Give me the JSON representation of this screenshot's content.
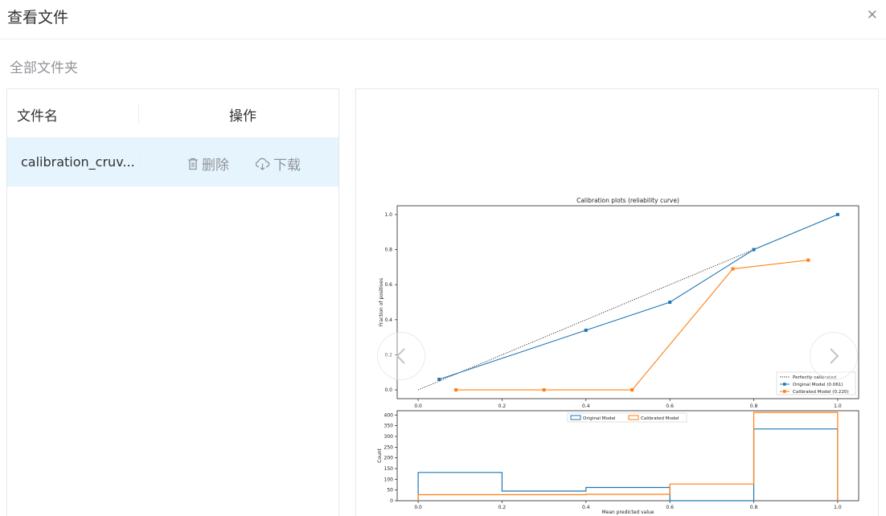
{
  "dialog": {
    "title": "查看文件",
    "close_glyph": "✕"
  },
  "breadcrumb": {
    "label": "全部文件夹"
  },
  "table": {
    "headers": {
      "name": "文件名",
      "actions": "操作"
    },
    "rows": [
      {
        "name": "calibration_cruv...",
        "delete_label": "删除",
        "download_label": "下载"
      }
    ]
  },
  "icons": {
    "delete": "trash-icon",
    "download": "cloud-download-icon",
    "prev": "chevron-left-icon",
    "next": "chevron-right-icon"
  },
  "colors": {
    "original": "#1f77b4",
    "calibrated": "#ff7f0e",
    "row_highlight": "#e6f4fd"
  },
  "chart_data": [
    {
      "type": "line",
      "title": "Calibration plots  (reliability curve)",
      "xlabel": "",
      "ylabel": "Fraction of positives",
      "xlim": [
        -0.05,
        1.05
      ],
      "ylim": [
        -0.05,
        1.05
      ],
      "xticks": [
        "0.0",
        "0.2",
        "0.4",
        "0.6",
        "0.8",
        "1.0"
      ],
      "yticks": [
        "0.0",
        "0.2",
        "0.4",
        "0.6",
        "0.8",
        "1.0"
      ],
      "legend_position": "bottom-right",
      "series": [
        {
          "name": "Perfectly calibrated",
          "style": "dotted",
          "color": "#222222",
          "x": [
            0,
            1
          ],
          "y": [
            0,
            1
          ]
        },
        {
          "name": "Original Model (0.061)",
          "style": "line-square",
          "color": "#1f77b4",
          "x": [
            0.05,
            0.4,
            0.6,
            0.8,
            1.0
          ],
          "y": [
            0.06,
            0.34,
            0.5,
            0.8,
            1.0
          ]
        },
        {
          "name": "Calibrated Model (0.220)",
          "style": "line-square",
          "color": "#ff7f0e",
          "x": [
            0.09,
            0.3,
            0.51,
            0.75,
            0.93
          ],
          "y": [
            0.0,
            0.0,
            0.0,
            0.69,
            0.74
          ]
        }
      ]
    },
    {
      "type": "histogram",
      "title": "",
      "xlabel": "Mean predicted value",
      "ylabel": "Count",
      "xlim": [
        -0.05,
        1.05
      ],
      "ylim": [
        0,
        420
      ],
      "xticks": [
        "0.0",
        "0.2",
        "0.4",
        "0.6",
        "0.8",
        "1.0"
      ],
      "yticks": [
        "0",
        "50",
        "100",
        "150",
        "200",
        "250",
        "300",
        "350",
        "400"
      ],
      "legend_position": "top-center",
      "bin_edges": [
        0.0,
        0.2,
        0.4,
        0.6,
        0.8,
        1.0
      ],
      "series": [
        {
          "name": "Original Model",
          "color": "#1f77b4",
          "counts": [
            132,
            45,
            62,
            0,
            335
          ]
        },
        {
          "name": "Calibrated Model",
          "color": "#ff7f0e",
          "counts": [
            28,
            28,
            30,
            78,
            412
          ]
        }
      ]
    }
  ]
}
